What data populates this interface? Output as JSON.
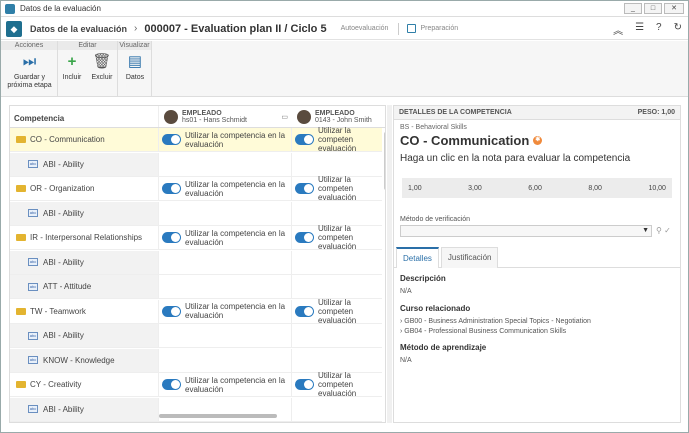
{
  "window": {
    "title": "Datos de la evaluación"
  },
  "header": {
    "section": "Datos de la evaluación",
    "main": "000007 - Evaluation plan II / Ciclo 5",
    "link1": "Autoevaluación",
    "link2": "Preparación"
  },
  "ribbon": {
    "groups": [
      "Acciones",
      "Editar",
      "Visualizar"
    ],
    "save_next": "Guardar y próxima etapa",
    "include": "Incluir",
    "exclude": "Excluir",
    "data": "Datos"
  },
  "grid": {
    "col_header": "Competencia",
    "employees": [
      {
        "label": "EMPLEADO",
        "name": "hs01 - Hans Schmidt"
      },
      {
        "label": "EMPLEADO",
        "name": "0143 - John Smith"
      }
    ],
    "toggle_text": "Utilizar la competencia en la evaluación",
    "toggle_text_cut": "Utilizar la competen evaluación",
    "rows": [
      {
        "type": "comp",
        "label": "CO - Communication",
        "selected": true,
        "toggles": true
      },
      {
        "type": "sub",
        "label": "ABI - Ability",
        "toggles": false
      },
      {
        "type": "comp",
        "label": "OR - Organization",
        "toggles": true
      },
      {
        "type": "sub",
        "label": "ABI - Ability",
        "toggles": false
      },
      {
        "type": "comp",
        "label": "IR - Interpersonal Relationships",
        "toggles": true
      },
      {
        "type": "sub",
        "label": "ABI - Ability",
        "toggles": false
      },
      {
        "type": "sub",
        "label": "ATT - Attitude",
        "toggles": false
      },
      {
        "type": "comp",
        "label": "TW - Teamwork",
        "toggles": true
      },
      {
        "type": "sub",
        "label": "ABI - Ability",
        "toggles": false
      },
      {
        "type": "sub",
        "label": "KNOW - Knowledge",
        "toggles": false
      },
      {
        "type": "comp",
        "label": "CY - Creativity",
        "toggles": true
      },
      {
        "type": "sub",
        "label": "ABI - Ability",
        "toggles": false
      }
    ]
  },
  "details": {
    "header": "DETALLES DE LA COMPETENCIA",
    "weight": "PESO: 1,00",
    "category": "BS - Behavioral Skills",
    "title": "CO - Communication",
    "hint": "Haga un clic en la nota para evaluar la competencia",
    "scale": [
      "1,00",
      "3,00",
      "6,00",
      "8,00",
      "10,00"
    ],
    "verif_label": "Método de verificación",
    "tabs": [
      "Detalles",
      "Justificación"
    ],
    "desc_h": "Descripción",
    "desc_v": "N/A",
    "course_h": "Curso relacionado",
    "courses": [
      "› GB00 - Business Administration Special Topics - Negotiation",
      "› GB04 - Professional Business Communication Skills"
    ],
    "learn_h": "Método de aprendizaje",
    "learn_v": "N/A"
  }
}
